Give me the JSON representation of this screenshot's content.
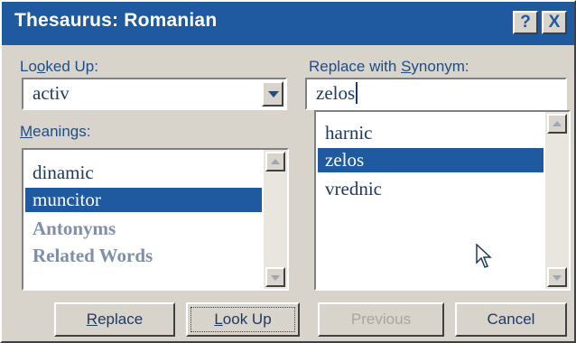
{
  "window": {
    "title": "Thesaurus: Romanian"
  },
  "titlebar": {
    "help_label": "?",
    "close_label": "X"
  },
  "looked_up": {
    "label_pre": "Lo",
    "label_key": "o",
    "label_post": "ked Up:",
    "value": "activ"
  },
  "replace_with": {
    "label_pre": "Replace with ",
    "label_key": "S",
    "label_post": "ynonym:",
    "value": "zelos"
  },
  "meanings": {
    "label_key": "M",
    "label_post": "eanings:",
    "items": [
      {
        "text": "dinamic"
      },
      {
        "text": "muncitor",
        "selected": true
      },
      {
        "text": "Antonyms"
      },
      {
        "text": "Related Words"
      }
    ]
  },
  "synonyms": {
    "items": [
      {
        "text": "harnic"
      },
      {
        "text": "zelos",
        "selected": true
      },
      {
        "text": "vrednic"
      }
    ]
  },
  "buttons": {
    "replace": {
      "key": "R",
      "rest": "eplace"
    },
    "lookup": {
      "key": "L",
      "rest": "ook Up"
    },
    "previous": "Previous",
    "cancel": "Cancel"
  },
  "colors": {
    "title_bar": "#1f5aa0",
    "selection": "#1f5aa0",
    "face": "#d8d4cb"
  }
}
